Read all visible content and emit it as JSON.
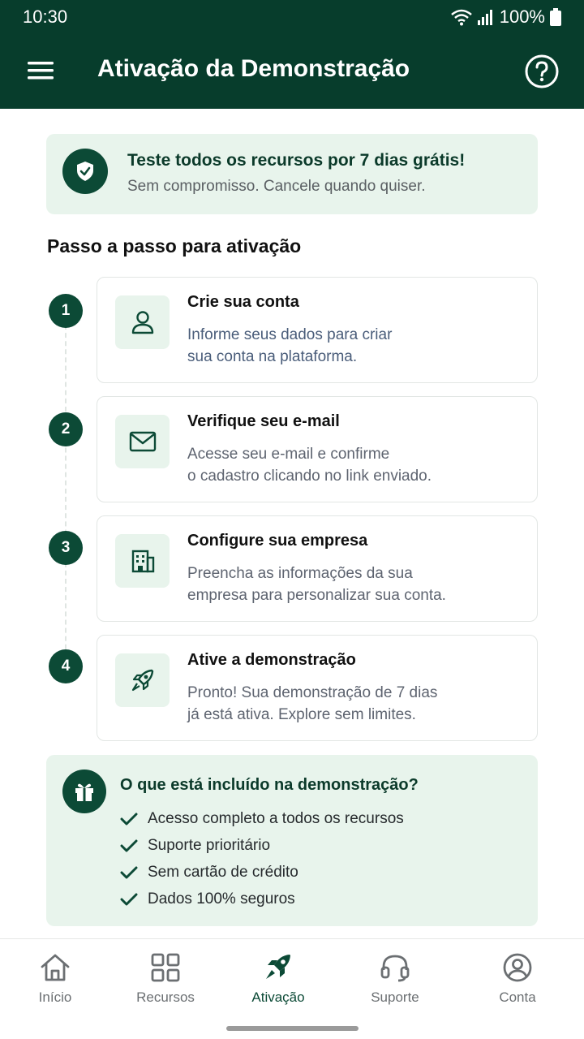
{
  "status_bar": {
    "time": "10:30",
    "battery": "100%"
  },
  "app_bar": {
    "title": "Ativação da Demonstração"
  },
  "trial_banner": {
    "title": "Teste todos os recursos por 7 dias grátis!",
    "subtitle": "Sem compromisso. Cancele quando quiser."
  },
  "section": {
    "title": "Passo a passo para ativação"
  },
  "steps": [
    {
      "number": "1",
      "title": "Crie sua conta",
      "line1": "Informe seus dados para criar",
      "line2": "sua conta na plataforma.",
      "icon": "user-icon"
    },
    {
      "number": "2",
      "title": "Verifique seu e-mail",
      "line1": "Acesse seu e-mail e confirme",
      "line2": "o cadastro clicando no link enviado.",
      "icon": "mail-icon"
    },
    {
      "number": "3",
      "title": "Configure sua empresa",
      "line1": "Preencha as informações da sua",
      "line2": "empresa para personalizar sua conta.",
      "icon": "building-icon"
    },
    {
      "number": "4",
      "title": "Ative a demonstração",
      "line1": "Pronto! Sua demonstração de 7 dias",
      "line2": "já está ativa. Explore sem limites.",
      "icon": "rocket-icon"
    }
  ],
  "included": {
    "title": "O que está incluído na demonstração?",
    "items": [
      "Acesso completo a todos os recursos",
      "Suporte prioritário",
      "Sem cartão de crédito",
      "Dados 100% seguros"
    ]
  },
  "nav": {
    "items": [
      {
        "label": "Início",
        "icon": "home-icon"
      },
      {
        "label": "Recursos",
        "icon": "grid-icon"
      },
      {
        "label": "Ativação",
        "icon": "rocket-icon",
        "active": true
      },
      {
        "label": "Suporte",
        "icon": "headset-icon"
      },
      {
        "label": "Conta",
        "icon": "account-icon"
      }
    ]
  },
  "colors": {
    "primary": "#073d2c",
    "accent": "#0c4a36",
    "tint": "#e8f4ec"
  }
}
